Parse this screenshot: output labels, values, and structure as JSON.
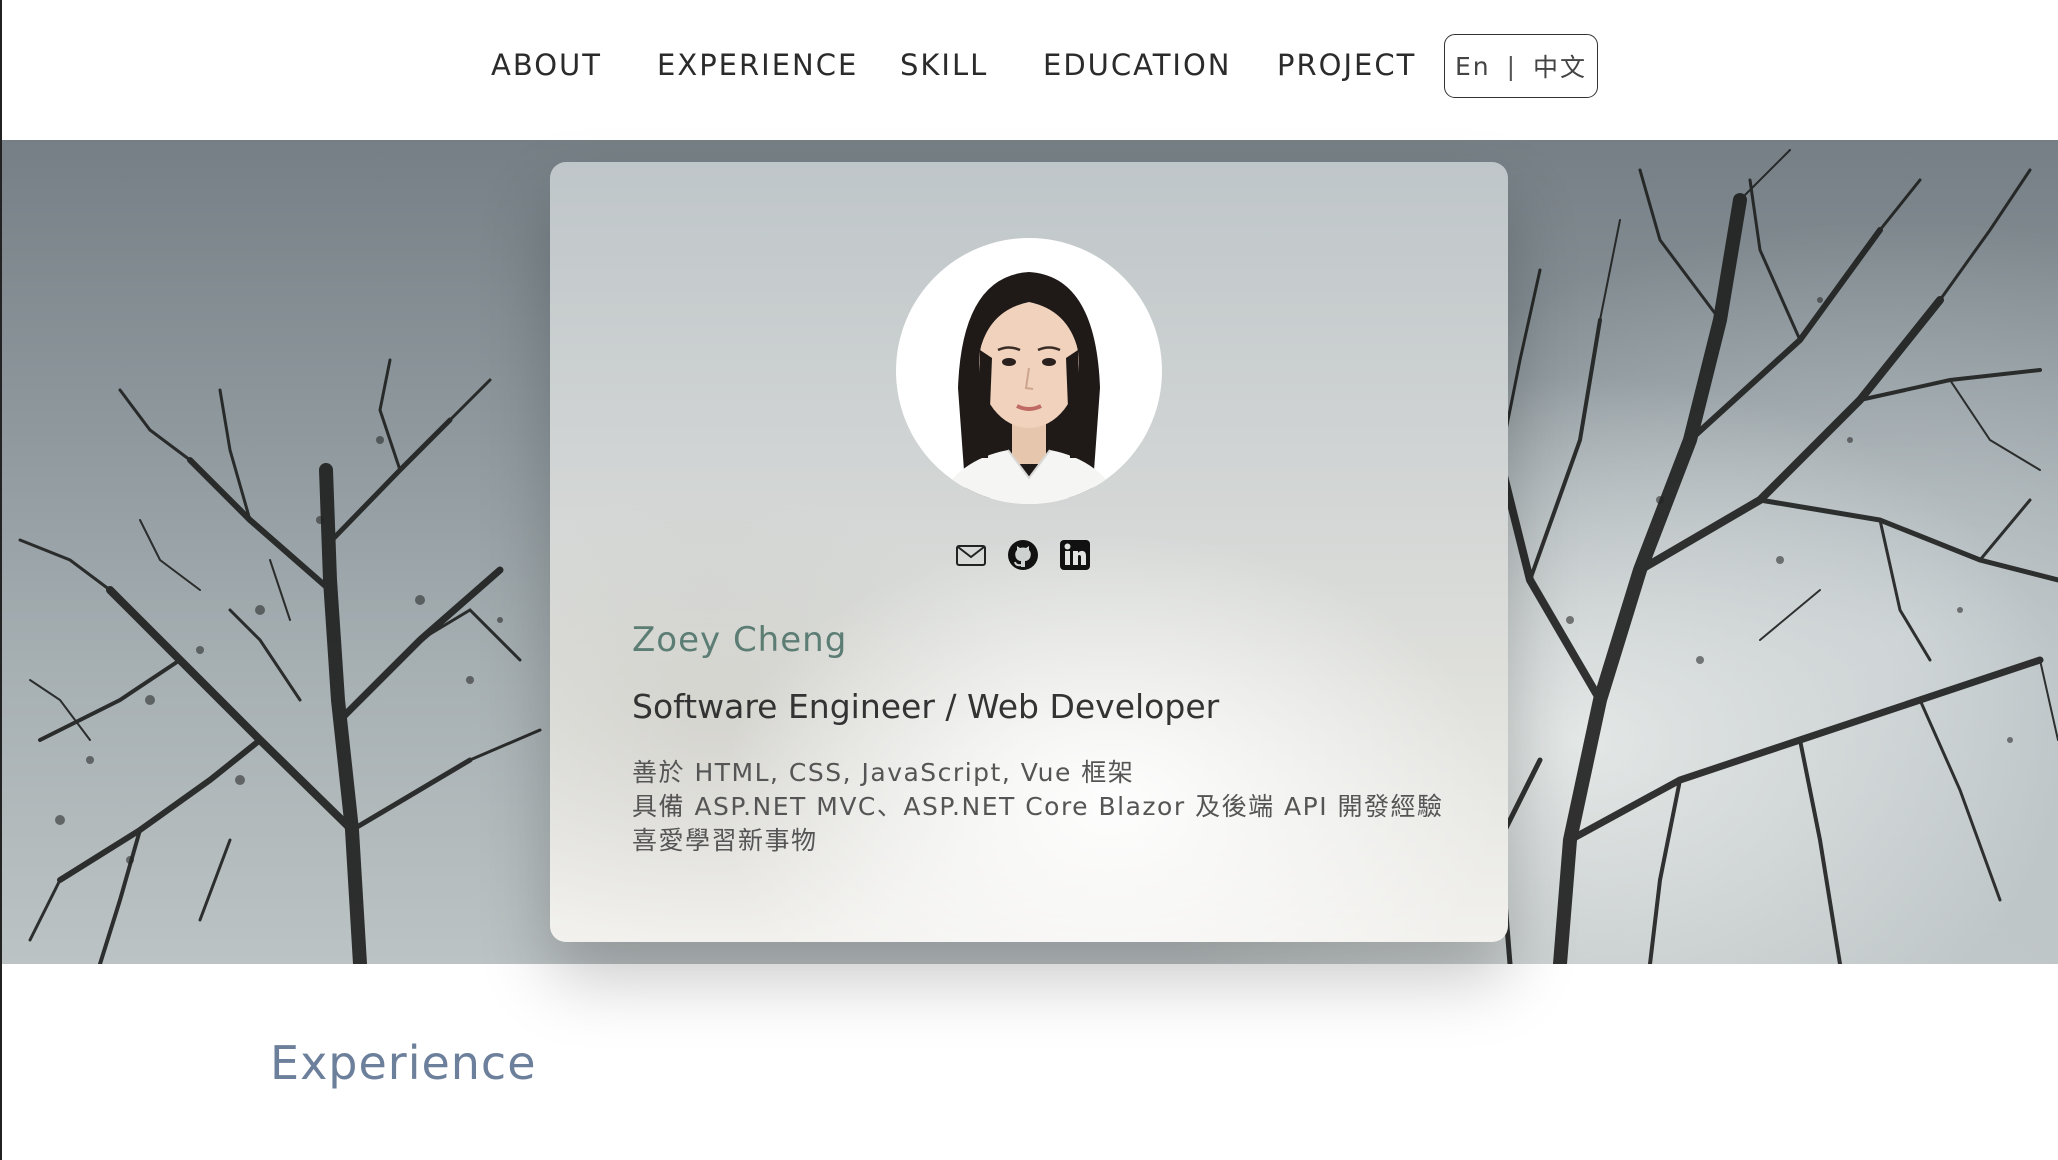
{
  "nav": {
    "items": [
      {
        "label": "ABOUT"
      },
      {
        "label": "EXPERIENCE"
      },
      {
        "label": "SKILL"
      },
      {
        "label": "EDUCATION"
      },
      {
        "label": "PROJECT"
      }
    ],
    "lang": {
      "en": "En",
      "separator": "|",
      "zh": "中文"
    }
  },
  "profile": {
    "name": "Zoey Cheng",
    "role": "Software Engineer / Web Developer",
    "bio": [
      "善於 HTML, CSS, JavaScript, Vue 框架",
      "具備 ASP.NET MVC、ASP.NET Core Blazor 及後端 API 開發經驗",
      "喜愛學習新事物"
    ],
    "social_icons": [
      "mail-icon",
      "github-icon",
      "linkedin-icon"
    ]
  },
  "sections": {
    "next_title": "Experience"
  },
  "colors": {
    "name_accent": "#5c7d74",
    "section_title": "#6c7f9b",
    "nav_text": "#2b2b2b"
  }
}
